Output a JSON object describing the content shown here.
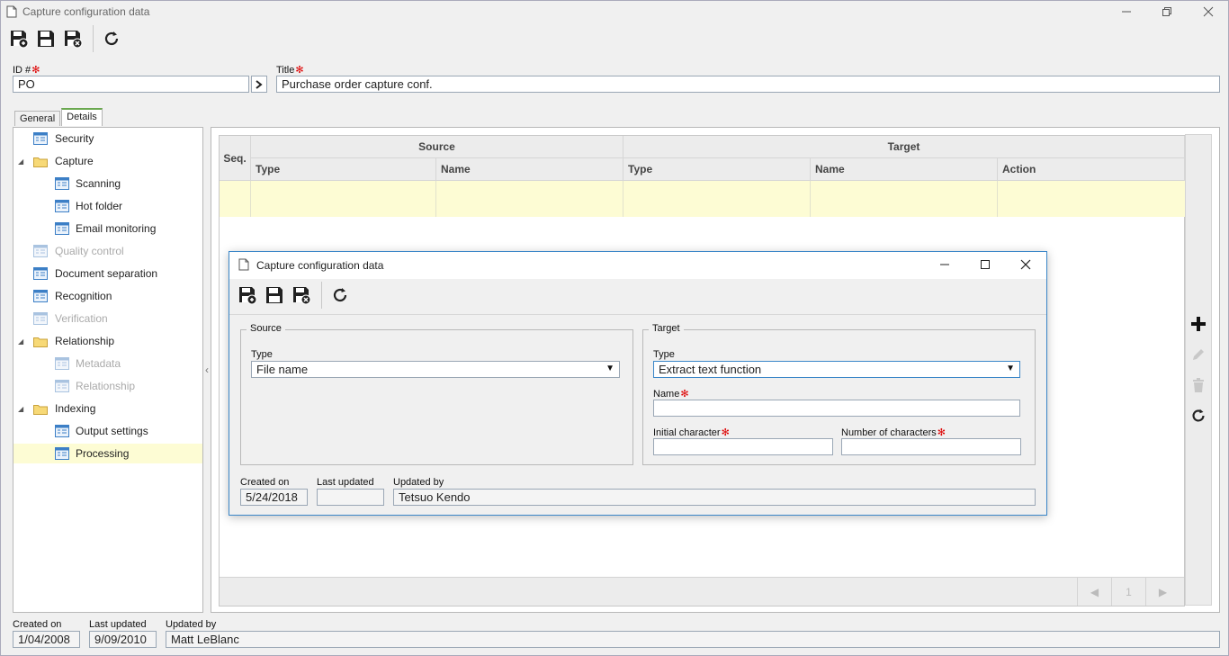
{
  "window": {
    "title": "Capture configuration data"
  },
  "toolbar": {
    "save_new": "save-new",
    "save": "save",
    "save_close": "save-close",
    "refresh": "refresh"
  },
  "form": {
    "id_label": "ID #",
    "id_value": "PO",
    "title_label": "Title",
    "title_value": "Purchase order capture conf."
  },
  "tabs": [
    {
      "label": "General"
    },
    {
      "label": "Details"
    }
  ],
  "tree": {
    "items": [
      {
        "label": "Security"
      },
      {
        "label": "Capture"
      },
      {
        "label": "Scanning"
      },
      {
        "label": "Hot folder"
      },
      {
        "label": "Email monitoring"
      },
      {
        "label": "Quality control"
      },
      {
        "label": "Document separation"
      },
      {
        "label": "Recognition"
      },
      {
        "label": "Verification"
      },
      {
        "label": "Relationship"
      },
      {
        "label": "Metadata"
      },
      {
        "label": "Relationship"
      },
      {
        "label": "Indexing"
      },
      {
        "label": "Output settings"
      },
      {
        "label": "Processing"
      }
    ]
  },
  "grid": {
    "seq": "Seq.",
    "source": "Source",
    "target": "Target",
    "columns": [
      "Type",
      "Name",
      "Type",
      "Name",
      "Action"
    ],
    "page": "1"
  },
  "dialog": {
    "title": "Capture configuration data",
    "source_legend": "Source",
    "source_type_label": "Type",
    "source_type_value": "File name",
    "target_legend": "Target",
    "target_type_label": "Type",
    "target_type_value": "Extract text function",
    "name_label": "Name",
    "name_value": "",
    "initial_char_label": "Initial character",
    "initial_char_value": "",
    "num_chars_label": "Number of characters",
    "num_chars_value": "",
    "created_on_label": "Created on",
    "created_on_value": "5/24/2018",
    "last_updated_label": "Last updated",
    "last_updated_value": "",
    "updated_by_label": "Updated by",
    "updated_by_value": "Tetsuo Kendo"
  },
  "footer": {
    "created_on_label": "Created on",
    "created_on_value": "1/04/2008",
    "last_updated_label": "Last updated",
    "last_updated_value": "9/09/2010",
    "updated_by_label": "Updated by",
    "updated_by_value": "Matt LeBlanc"
  },
  "required_mark": "✻"
}
